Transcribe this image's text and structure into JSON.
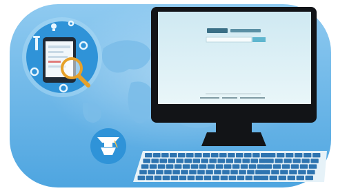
{
  "colors": {
    "page_bg": "#ffffff",
    "panel_top": "#8fcaf0",
    "panel_bottom": "#4ea5e0",
    "world_map": "#7bbde9",
    "circle_fill": "#2f93d8",
    "circle_ring": "#a9d8f4",
    "monitor_bezel": "#121417",
    "screen_top": "#cfe9f2",
    "screen_bottom": "#e9f6f9",
    "search_button": "#5fb6cf",
    "keyboard_body": "#e6f2f8",
    "key_color": "#2e74b0",
    "magnifier_ring": "#e6a12a",
    "device_frame": "#1f2a36",
    "device_screen": "#f1f7fb"
  },
  "icons": [
    "world-map-icon",
    "tablet-icon",
    "magnifier-icon",
    "lightbulb-icon",
    "gear-icon",
    "graduation-cap-icon",
    "monitor-icon",
    "keyboard-icon"
  ]
}
